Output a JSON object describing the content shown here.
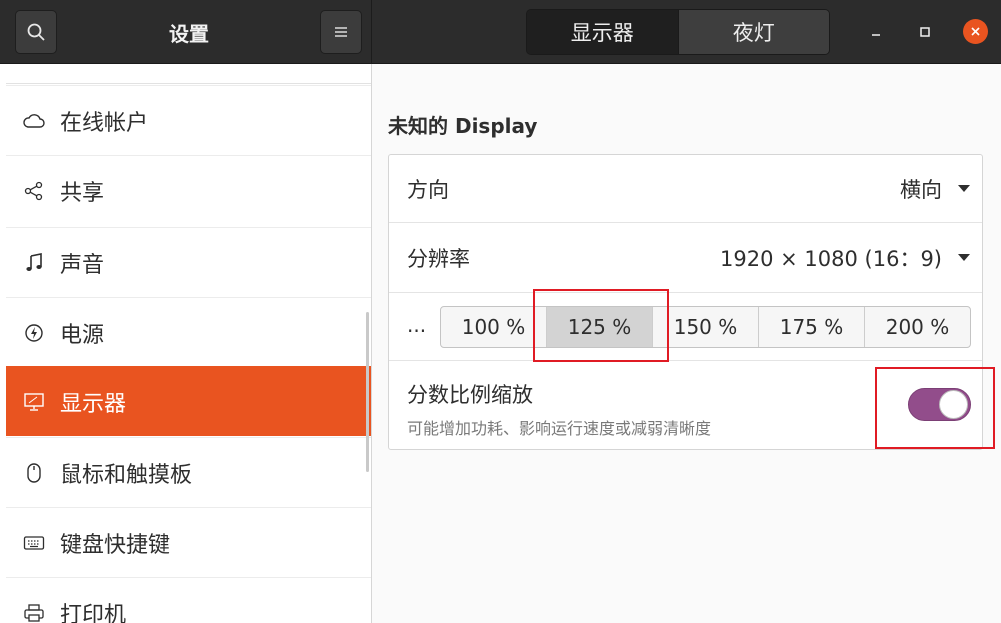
{
  "header": {
    "title": "设置",
    "search_icon": "search-icon",
    "menu_icon": "hamburger-menu-icon",
    "tabs": [
      {
        "label": "显示器",
        "active": true
      },
      {
        "label": "夜灯",
        "active": false
      }
    ],
    "window_controls": [
      "minimize-icon",
      "maximize-icon",
      "close-icon"
    ]
  },
  "sidebar": {
    "items": [
      {
        "label": "在线帐户",
        "icon": "cloud-icon",
        "active": false
      },
      {
        "label": "共享",
        "icon": "share-icon",
        "active": false
      },
      {
        "label": "声音",
        "icon": "music-note-icon",
        "active": false
      },
      {
        "label": "电源",
        "icon": "power-icon",
        "active": false
      },
      {
        "label": "显示器",
        "icon": "display-icon",
        "active": true
      },
      {
        "label": "鼠标和触摸板",
        "icon": "mouse-icon",
        "active": false
      },
      {
        "label": "键盘快捷键",
        "icon": "keyboard-icon",
        "active": false
      },
      {
        "label": "打印机",
        "icon": "printer-icon",
        "active": false
      }
    ]
  },
  "main": {
    "section_title": "未知的 Display",
    "orientation": {
      "label": "方向",
      "value": "横向"
    },
    "resolution": {
      "label": "分辨率",
      "value": "1920 × 1080 (16：9)"
    },
    "scale": {
      "prefix": "...",
      "options": [
        "100 %",
        "125 %",
        "150 %",
        "175 %",
        "200 %"
      ],
      "selected": "125 %"
    },
    "fractional_scaling": {
      "title": "分数比例缩放",
      "subtitle": "可能增加功耗、影响运行速度或减弱清晰度",
      "enabled": true
    }
  },
  "colors": {
    "accent": "#e95420",
    "toggle_on": "#924d8b",
    "highlight": "#e01b24"
  }
}
